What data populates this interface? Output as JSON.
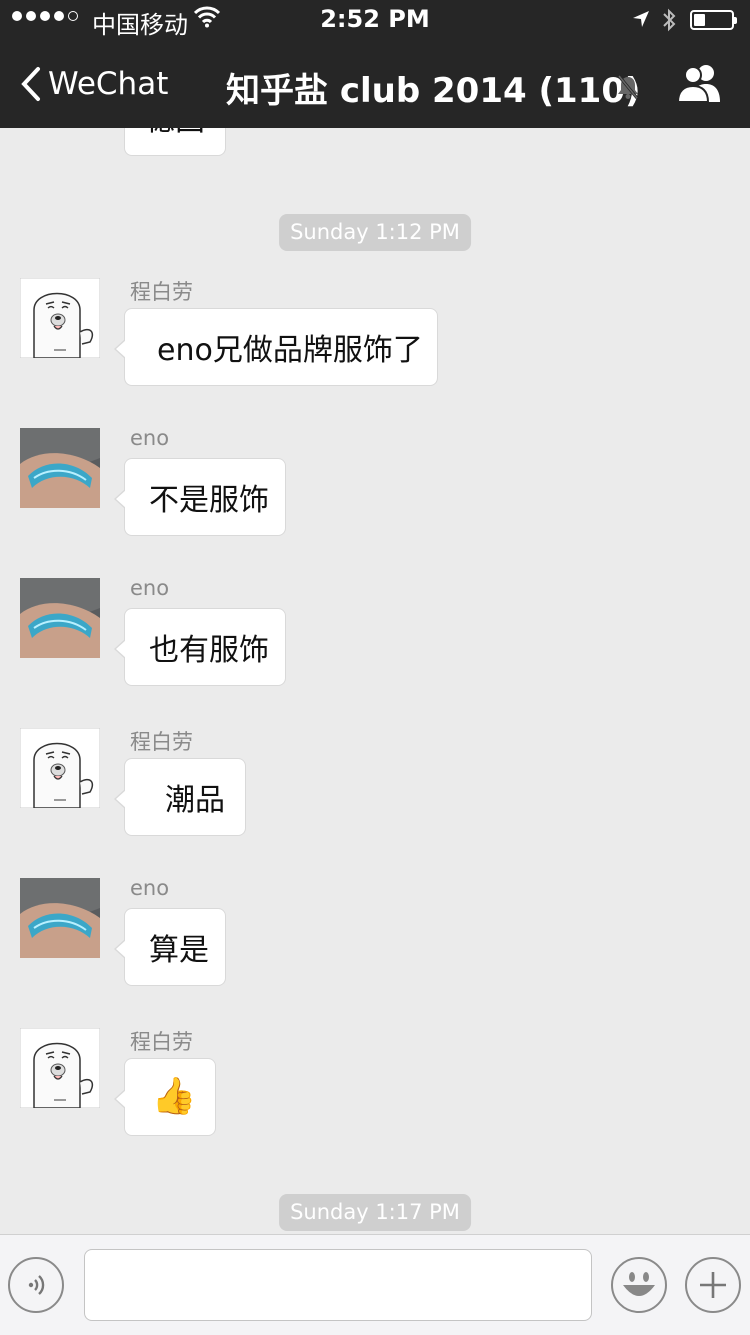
{
  "status_bar": {
    "carrier": "中国移动",
    "time": "2:52 PM",
    "battery_level": 0.3
  },
  "nav": {
    "back_label": "WeChat",
    "title": "知乎盐 club 2014 (110)"
  },
  "chat": {
    "cut_top_bubble_text": "稳固",
    "timestamp_1": "Sunday 1:12 PM",
    "timestamp_2": "Sunday 1:17 PM",
    "messages": [
      {
        "sender": "程白劳",
        "text": "eno兄做品牌服饰了",
        "avatar": "seal-avatar"
      },
      {
        "sender": "eno",
        "text": "不是服饰",
        "avatar": "wristband-photo-avatar"
      },
      {
        "sender": "eno",
        "text": "也有服饰",
        "avatar": "wristband-photo-avatar"
      },
      {
        "sender": "程白劳",
        "text": "潮品",
        "avatar": "seal-avatar"
      },
      {
        "sender": "eno",
        "text": "算是",
        "avatar": "wristband-photo-avatar"
      },
      {
        "sender": "程白劳",
        "text": "👍",
        "avatar": "seal-avatar"
      }
    ]
  },
  "input_bar": {
    "message_value": "",
    "icons": [
      "voice-icon",
      "emoji-icon",
      "plus-icon"
    ]
  },
  "colors": {
    "nav_background": "#262626",
    "chat_background": "#ebebeb",
    "timestamp_pill": "#cfcfcf",
    "bubble": "#ffffff"
  }
}
